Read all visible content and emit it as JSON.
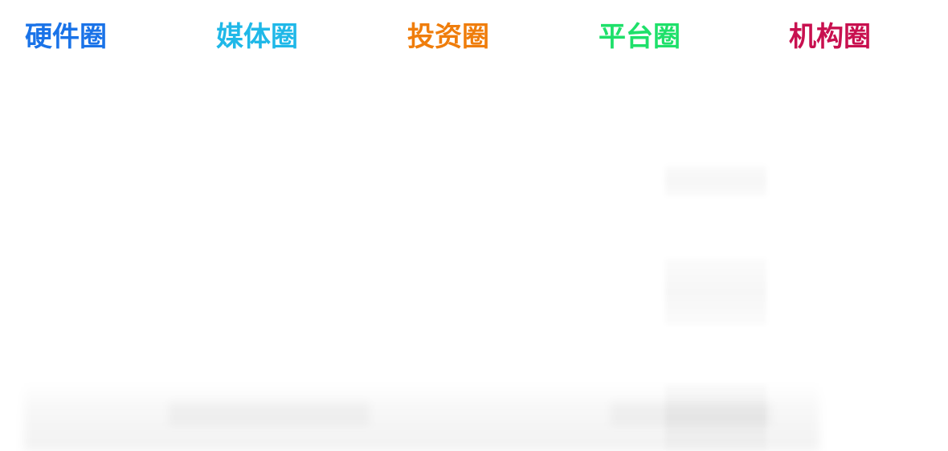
{
  "tabs": [
    {
      "label": "硬件圈",
      "color": "#1a73e8"
    },
    {
      "label": "媒体圈",
      "color": "#1fb8e8"
    },
    {
      "label": "投资圈",
      "color": "#ef7d0b"
    },
    {
      "label": "平台圈",
      "color": "#1ee06a"
    },
    {
      "label": "机构圈",
      "color": "#c8104f"
    }
  ]
}
